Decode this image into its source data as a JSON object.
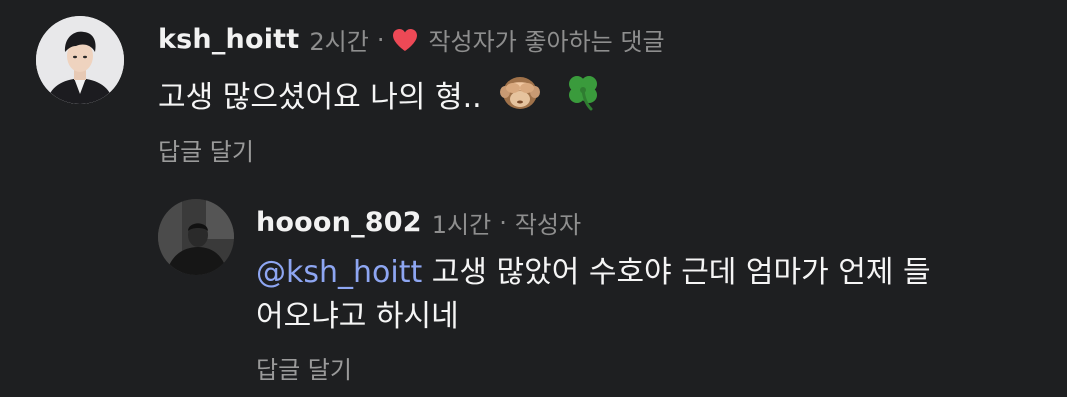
{
  "comment": {
    "username": "ksh_hoitt",
    "time": "2시간",
    "separator": "·",
    "liked_by_author": "작성자가 좋아하는 댓글",
    "text": "고생 많으셨어요 나의 형..",
    "emojis": [
      "see-no-evil-monkey-icon",
      "four-leaf-clover-icon"
    ],
    "reply_action": "답글 달기"
  },
  "reply": {
    "username": "hooon_802",
    "time": "1시간",
    "separator": "·",
    "author_badge": "작성자",
    "mention": "@ksh_hoitt",
    "text_line1": " 고생 많았어 수호야 근데 엄마가 언제 들",
    "text_line2": "어오냐고 하시네",
    "reply_action": "답글 달기"
  },
  "colors": {
    "background": "#1e1f21",
    "mention": "#8ea6f2",
    "heart": "#ed4956",
    "muted": "#8e8e8e"
  }
}
